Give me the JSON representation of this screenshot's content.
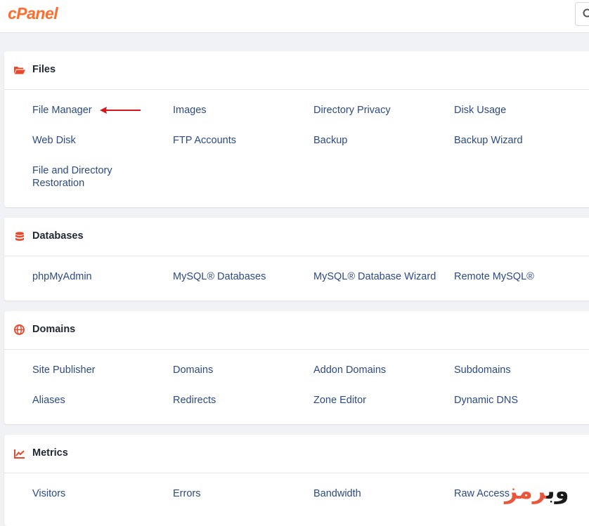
{
  "app": {
    "logo": "cPanel"
  },
  "colors": {
    "accent": "#ff6c2c",
    "link": "#2c4a87",
    "icon_red": "#e64a2e"
  },
  "sections": [
    {
      "title": "Files",
      "icon": "folder-open-icon",
      "items": [
        "File Manager",
        "Images",
        "Directory Privacy",
        "Disk Usage",
        "Web Disk",
        "FTP Accounts",
        "Backup",
        "Backup Wizard",
        "File and Directory Restoration"
      ]
    },
    {
      "title": "Databases",
      "icon": "database-icon",
      "items": [
        "phpMyAdmin",
        "MySQL® Databases",
        "MySQL® Database Wizard",
        "Remote MySQL®"
      ]
    },
    {
      "title": "Domains",
      "icon": "globe-icon",
      "items": [
        "Site Publisher",
        "Domains",
        "Addon Domains",
        "Subdomains",
        "Aliases",
        "Redirects",
        "Zone Editor",
        "Dynamic DNS"
      ]
    },
    {
      "title": "Metrics",
      "icon": "chart-line-icon",
      "items": [
        "Visitors",
        "Errors",
        "Bandwidth",
        "Raw Access"
      ]
    }
  ],
  "watermark": {
    "part1": "وب",
    "part2": "رمز"
  }
}
